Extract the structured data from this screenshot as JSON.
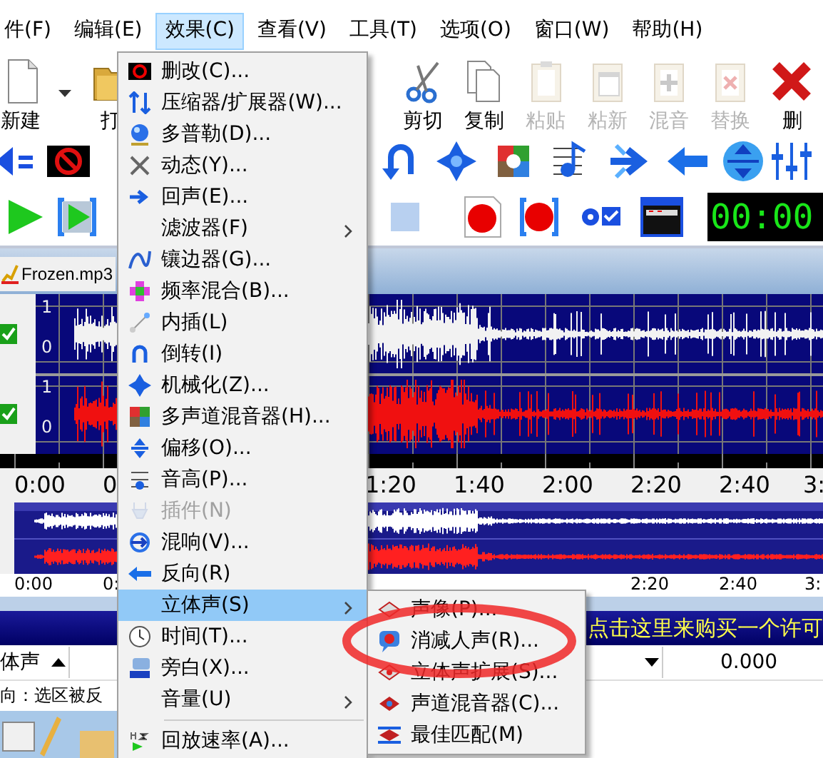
{
  "menu_bar": [
    {
      "label": "件(F)",
      "selected": false
    },
    {
      "label": "编辑(E)",
      "selected": false
    },
    {
      "label": "效果(C)",
      "selected": true
    },
    {
      "label": "查看(V)",
      "selected": false
    },
    {
      "label": "工具(T)",
      "selected": false
    },
    {
      "label": "选项(O)",
      "selected": false
    },
    {
      "label": "窗口(W)",
      "selected": false
    },
    {
      "label": "帮助(H)",
      "selected": false
    }
  ],
  "toolbar": {
    "left": [
      {
        "label": "新建",
        "disabled": false
      },
      {
        "label": "打",
        "disabled": false
      }
    ],
    "right": [
      {
        "label": "剪切",
        "disabled": false
      },
      {
        "label": "复制",
        "disabled": false
      },
      {
        "label": "粘贴",
        "disabled": true
      },
      {
        "label": "粘新",
        "disabled": true
      },
      {
        "label": "混音",
        "disabled": true
      },
      {
        "label": "替换",
        "disabled": true
      },
      {
        "label": "删",
        "disabled": false
      }
    ]
  },
  "transport": {
    "stop_disabled": true,
    "timer": "00:00"
  },
  "document": {
    "title": "Frozen.mp3",
    "scale_labels": [
      "1",
      "0",
      "1",
      "0"
    ],
    "timeline": [
      "0:00",
      "0",
      "1:20",
      "1:40",
      "2:00",
      "2:20",
      "2:40",
      "3:"
    ],
    "overview_timeline": [
      "0:00",
      "0:",
      "2:20",
      "2:40",
      "3:"
    ]
  },
  "purchase_banner": "点击这里来购买一个许可",
  "control_row": {
    "channel": "体声",
    "value": "0.000"
  },
  "status_bar": "向：选区被反",
  "effects_menu": [
    {
      "kind": "command",
      "label": "删改(C)...",
      "disabled": false,
      "selected": false,
      "submenu": false
    },
    {
      "kind": "command",
      "label": "压缩器/扩展器(W)...",
      "disabled": false,
      "selected": false,
      "submenu": false
    },
    {
      "kind": "command",
      "label": "多普勒(D)...",
      "disabled": false,
      "selected": false,
      "submenu": false
    },
    {
      "kind": "command",
      "label": "动态(Y)...",
      "disabled": false,
      "selected": false,
      "submenu": false
    },
    {
      "kind": "command",
      "label": "回声(E)...",
      "disabled": false,
      "selected": false,
      "submenu": false
    },
    {
      "kind": "command",
      "label": "滤波器(F)",
      "disabled": false,
      "selected": false,
      "submenu": true
    },
    {
      "kind": "command",
      "label": "镶边器(G)...",
      "disabled": false,
      "selected": false,
      "submenu": false
    },
    {
      "kind": "command",
      "label": "频率混合(B)...",
      "disabled": false,
      "selected": false,
      "submenu": false
    },
    {
      "kind": "command",
      "label": "内插(L)",
      "disabled": false,
      "selected": false,
      "submenu": false
    },
    {
      "kind": "command",
      "label": "倒转(I)",
      "disabled": false,
      "selected": false,
      "submenu": false
    },
    {
      "kind": "command",
      "label": "机械化(Z)...",
      "disabled": false,
      "selected": false,
      "submenu": false
    },
    {
      "kind": "command",
      "label": "多声道混音器(H)...",
      "disabled": false,
      "selected": false,
      "submenu": false
    },
    {
      "kind": "command",
      "label": "偏移(O)...",
      "disabled": false,
      "selected": false,
      "submenu": false
    },
    {
      "kind": "command",
      "label": "音高(P)...",
      "disabled": false,
      "selected": false,
      "submenu": false
    },
    {
      "kind": "command",
      "label": "插件(N)",
      "disabled": true,
      "selected": false,
      "submenu": false
    },
    {
      "kind": "command",
      "label": "混响(V)...",
      "disabled": false,
      "selected": false,
      "submenu": false
    },
    {
      "kind": "command",
      "label": "反向(R)",
      "disabled": false,
      "selected": false,
      "submenu": false
    },
    {
      "kind": "command",
      "label": "立体声(S)",
      "disabled": false,
      "selected": true,
      "submenu": true
    },
    {
      "kind": "command",
      "label": "时间(T)...",
      "disabled": false,
      "selected": false,
      "submenu": false
    },
    {
      "kind": "command",
      "label": "旁白(X)...",
      "disabled": false,
      "selected": false,
      "submenu": false
    },
    {
      "kind": "command",
      "label": "音量(U)",
      "disabled": false,
      "selected": false,
      "submenu": true
    },
    {
      "kind": "separator"
    },
    {
      "kind": "command",
      "label": "回放速率(A)...",
      "disabled": false,
      "selected": false,
      "submenu": false
    }
  ],
  "stereo_submenu": [
    {
      "label": "声像(P)...",
      "disabled": false
    },
    {
      "label": "消减人声(R)...",
      "disabled": false
    },
    {
      "label": "立体声扩展(S)...",
      "disabled": false
    },
    {
      "label": "声道混音器(C)...",
      "disabled": false
    },
    {
      "label": "最佳匹配(M)",
      "disabled": false
    }
  ]
}
